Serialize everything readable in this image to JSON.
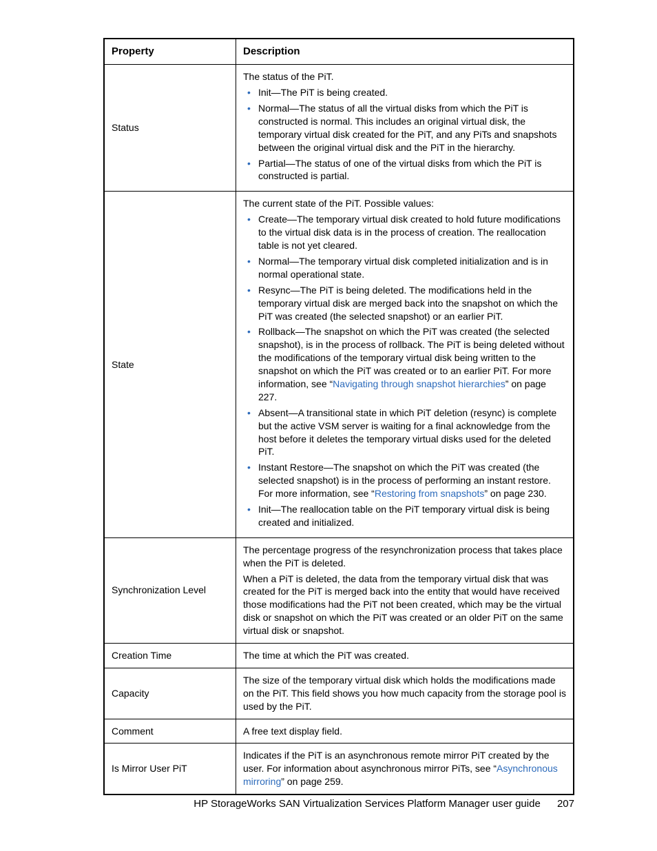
{
  "table": {
    "headers": {
      "property": "Property",
      "description": "Description"
    },
    "rows": [
      {
        "property": "Status",
        "intro": "The status of the PiT.",
        "bullets": [
          {
            "text": "Init—The PiT is being created."
          },
          {
            "text": "Normal—The status of all the virtual disks from which the PiT is constructed is normal. This includes an original virtual disk, the temporary virtual disk created for the PiT, and any PiTs and snapshots between the original virtual disk and the PiT in the hierarchy."
          },
          {
            "text": "Partial—The status of one of the virtual disks from which the PiT is constructed is partial."
          }
        ]
      },
      {
        "property": "State",
        "intro": "The current state of the PiT. Possible values:",
        "bullets": [
          {
            "text": "Create—The temporary virtual disk created to hold future modifications to the virtual disk data is in the process of creation. The reallocation table is not yet cleared."
          },
          {
            "text": "Normal—The temporary virtual disk completed initialization and is in normal operational state."
          },
          {
            "text": "Resync—The PiT is being deleted. The modifications held in the temporary virtual disk are merged back into the snapshot on which the PiT was created (the selected snapshot) or an earlier PiT."
          },
          {
            "pre": "Rollback—The snapshot on which the PiT was created (the selected snapshot), is in the process of rollback. The PiT is being deleted without the modifications of the temporary virtual disk being written to the snapshot on which the PiT was created or to an earlier PiT. For more information, see “",
            "link": "Navigating through snapshot hierarchies",
            "post": "” on page 227."
          },
          {
            "text": "Absent—A transitional state in which PiT deletion (resync) is complete but the active VSM server is waiting for a final acknowledge from the host before it deletes the temporary virtual disks used for the deleted PiT."
          },
          {
            "pre": "Instant Restore—The snapshot on which the PiT was created (the selected snapshot) is in the process of performing an instant restore. For more information, see “",
            "link": "Restoring from snapshots",
            "post": "” on page 230."
          },
          {
            "text": "Init—The reallocation table on the PiT temporary virtual disk is being created and initialized."
          }
        ]
      },
      {
        "property": "Synchronization Level",
        "paras": [
          "The percentage progress of the resynchronization process that takes place when the PiT is deleted.",
          "When a PiT is deleted, the data from the temporary virtual disk that was created for the PiT is merged back into the entity that would have received those modifications had the PiT not been created, which may be the virtual disk or snapshot on which the PiT was created or an older PiT on the same virtual disk or snapshot."
        ]
      },
      {
        "property": "Creation Time",
        "paras": [
          "The time at which the PiT was created."
        ]
      },
      {
        "property": "Capacity",
        "paras": [
          "The size of the temporary virtual disk which holds the modifications made on the PiT. This field shows you how much capacity from the storage pool is used by the PiT."
        ]
      },
      {
        "property": "Comment",
        "paras": [
          "A free text display field."
        ]
      },
      {
        "property": "Is Mirror User PiT",
        "mixed": {
          "pre": "Indicates if the PiT is an asynchronous remote mirror PiT created by the user. For information about asynchronous mirror PiTs, see “",
          "link": "Asynchronous mirroring",
          "post": "” on page 259."
        }
      }
    ]
  },
  "footer": {
    "title": "HP StorageWorks SAN Virtualization Services Platform Manager user guide",
    "page": "207"
  }
}
